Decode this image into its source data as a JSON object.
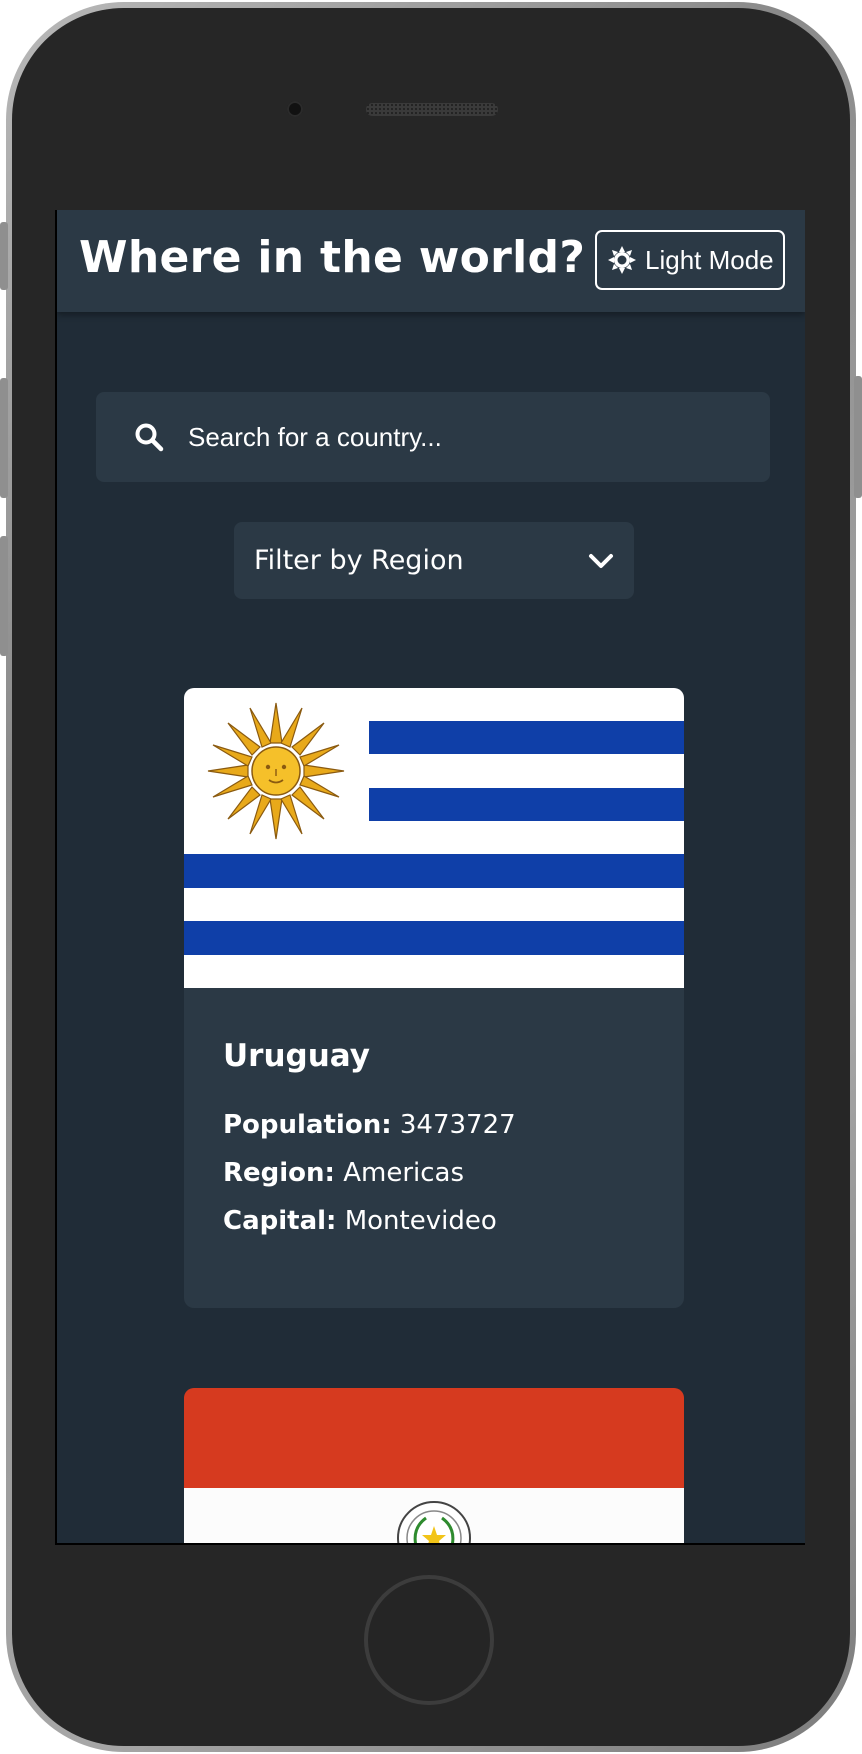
{
  "header": {
    "title": "Where in the world?",
    "mode_label": "Light Mode",
    "mode_icon": "sun-icon"
  },
  "search": {
    "placeholder": "Search for a country...",
    "icon": "search-icon"
  },
  "filter": {
    "label": "Filter by Region",
    "icon": "chevron-down-icon"
  },
  "labels": {
    "population": "Population:",
    "region": "Region:",
    "capital": "Capital:"
  },
  "countries": [
    {
      "name": "Uruguay",
      "population": "3473727",
      "region": "Americas",
      "capital": "Montevideo",
      "flag": "uruguay-flag"
    },
    {
      "name": "",
      "flag": "paraguay-flag"
    }
  ],
  "colors": {
    "background": "#202c37",
    "elements": "#2b3945",
    "text": "#ffffff"
  }
}
